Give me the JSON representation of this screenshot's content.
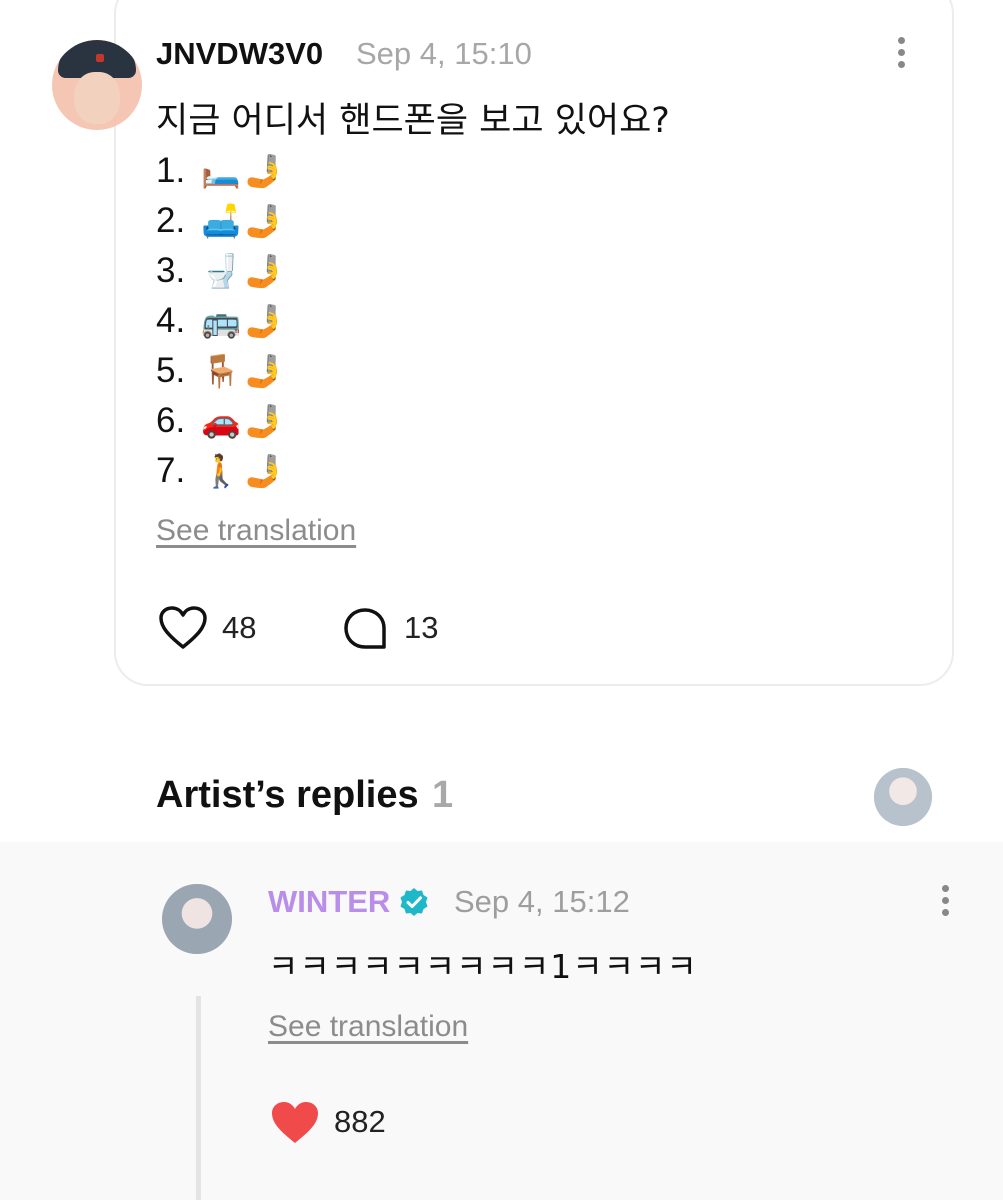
{
  "post": {
    "author": "JNVDW3V0",
    "time": "Sep 4, 15:10",
    "text": "지금 어디서 핸드폰을 보고 있어요?",
    "items": [
      {
        "num": "1.",
        "emoji": "🛏️",
        "hand": "🤳"
      },
      {
        "num": "2.",
        "emoji": "🛋️",
        "hand": "🤳"
      },
      {
        "num": "3.",
        "emoji": "🚽",
        "hand": "🤳"
      },
      {
        "num": "4.",
        "emoji": "🚌",
        "hand": "🤳"
      },
      {
        "num": "5.",
        "emoji": "🪑",
        "hand": "🤳"
      },
      {
        "num": "6.",
        "emoji": "🚗",
        "hand": "🤳"
      },
      {
        "num": "7.",
        "emoji": "🚶",
        "hand": "🤳"
      }
    ],
    "translate_label": "See translation",
    "likes": "48",
    "comments": "13"
  },
  "artist_replies": {
    "title": "Artist’s replies",
    "count": "1"
  },
  "reply": {
    "author": "WINTER",
    "time": "Sep 4, 15:12",
    "text": "ㅋㅋㅋㅋㅋㅋㅋㅋㅋ1ㅋㅋㅋㅋ",
    "translate_label": "See translation",
    "likes": "882"
  },
  "colors": {
    "artist_name": "#b98ee8",
    "verified_badge": "#1fb8c9",
    "liked_heart": "#f04a4a"
  }
}
